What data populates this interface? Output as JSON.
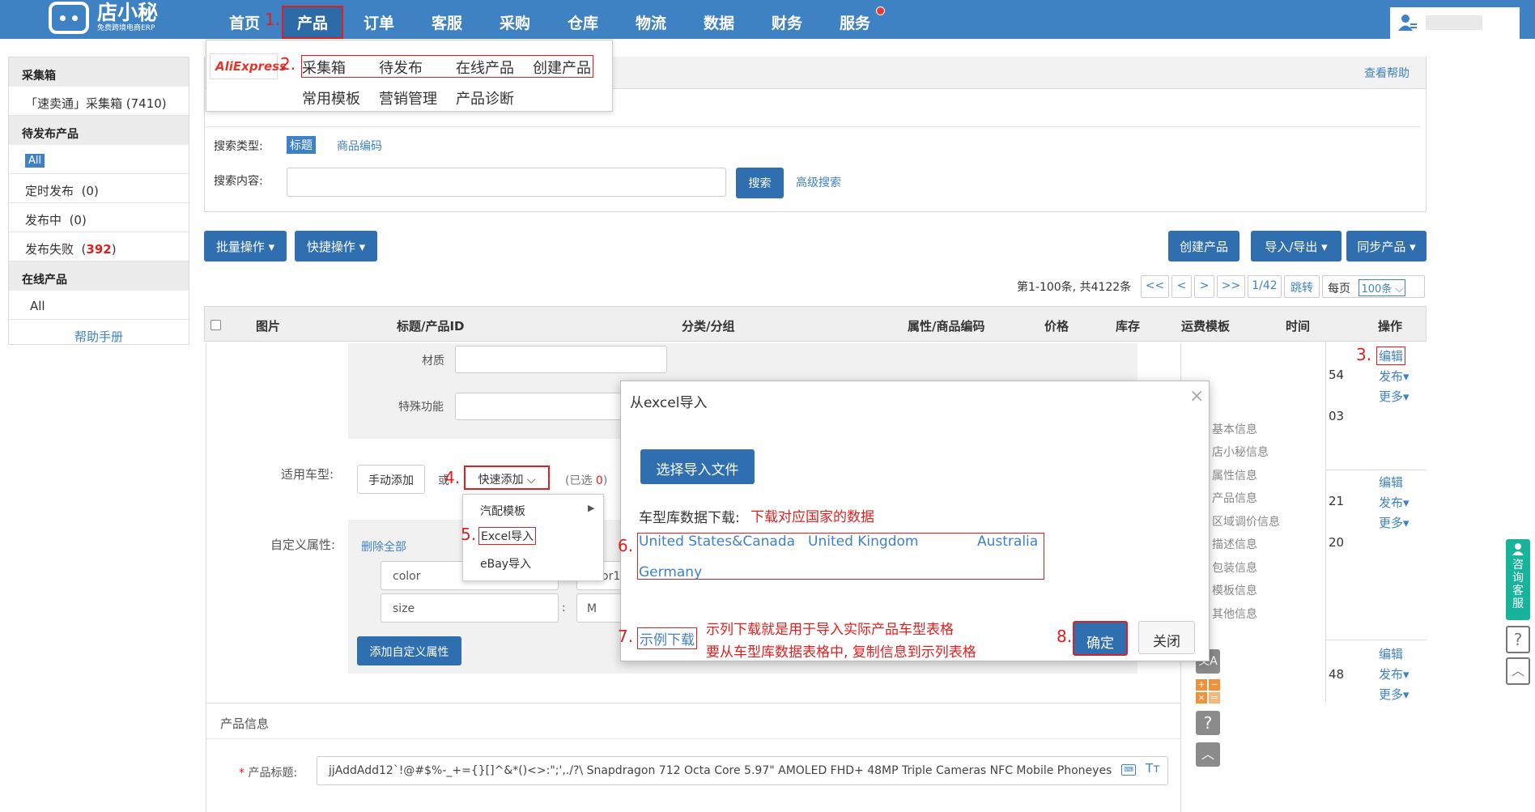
{
  "topbar": {
    "logo_title": "店小秘",
    "logo_subtitle": "免费跨境电商ERP",
    "nav": [
      "首页",
      "产品",
      "订单",
      "客服",
      "采购",
      "仓库",
      "物流",
      "数据",
      "财务",
      "服务"
    ]
  },
  "annotations": [
    "1.",
    "2.",
    "3.",
    "4.",
    "5.",
    "6.",
    "7.",
    "8."
  ],
  "product_menu": {
    "brand": "AliExpress",
    "row1": [
      "采集箱",
      "待发布",
      "在线产品",
      "创建产品"
    ],
    "row2": [
      "常用模板",
      "营销管理",
      "产品诊断"
    ]
  },
  "header": {
    "help_link": "查看帮助"
  },
  "sidebar": {
    "collect_title": "采集箱",
    "collect_item": "「速卖通」采集箱 (7410)",
    "pending_title": "待发布产品",
    "pending_all": "All",
    "scheduled": "定时发布",
    "scheduled_count": "(0)",
    "publishing": "发布中",
    "publishing_count": "(0)",
    "failed": "发布失败",
    "failed_count": "392",
    "online_title": "在线产品",
    "online_all": "All",
    "help_manual": "帮助手册"
  },
  "search": {
    "type_label": "搜索类型:",
    "type_title": "标题",
    "type_code": "商品编码",
    "content_label": "搜索内容:",
    "search_button": "搜索",
    "advanced": "高级搜索"
  },
  "toolbar": {
    "batch": "批量操作",
    "quick": "快捷操作",
    "create": "创建产品",
    "import_export": "导入/导出",
    "sync": "同步产品"
  },
  "pagination": {
    "summary": "第1-100条, 共4122条",
    "first": "<<",
    "prev": "<",
    "next": ">",
    "last": ">>",
    "page": "1/42",
    "jump": "跳转",
    "per_page_label": "每页",
    "per_page_value": "100条"
  },
  "table": {
    "headers": [
      "图片",
      "标题/产品ID",
      "分类/分组",
      "属性/商品编码",
      "价格",
      "库存",
      "运费模板",
      "时间",
      "操作"
    ]
  },
  "editor": {
    "material_label": "材质",
    "special_label": "特殊功能",
    "car_label": "适用车型:",
    "manual_add": "手动添加",
    "or_text": "或",
    "quick_add": "快速添加",
    "selected_prefix": "(已选 ",
    "selected_count": "0",
    "selected_suffix": ")",
    "custom_label": "自定义属性:",
    "delete_all": "删除全部",
    "attrs": [
      {
        "name": "color",
        "value": "or1"
      },
      {
        "name": "size",
        "value": "M"
      }
    ],
    "add_custom": "添加自定义属性",
    "quick_menu": [
      "汽配模板",
      "Excel导入",
      "eBay导入"
    ]
  },
  "rail": [
    "基本信息",
    "店小秘信息",
    "属性信息",
    "产品信息",
    "区域调价信息",
    "描述信息",
    "包装信息",
    "模板信息",
    "其他信息"
  ],
  "ops": {
    "edit": "编辑",
    "publish": "发布",
    "more": "更多"
  },
  "right_numbers": [
    "54",
    "03",
    "21",
    "20",
    "48"
  ],
  "dialog": {
    "title": "从excel导入",
    "choose_file": "选择导入文件",
    "download_label": "车型库数据下载:",
    "download_note": "下载对应国家的数据",
    "countries": [
      "United States&Canada",
      "United Kingdom",
      "Australia",
      "Germany"
    ],
    "sample": "示例下载",
    "note1": "示列下载就是用于导入实际产品车型表格",
    "note2": "要从车型库数据表格中, 复制信息到示列表格",
    "confirm": "确定",
    "close": "关闭"
  },
  "product_info": {
    "section_title": "产品信息",
    "title_label": "产品标题:",
    "title_value": "jjAddAdd12`!@#$%-_+={}[]^&*()<>:\";',./?\\ Snapdragon 712 Octa Core 5.97\" AMOLED FHD+ 48MP Triple Cameras NFC Mobile Phoneyes"
  },
  "service": {
    "consult": "咨询客服"
  }
}
